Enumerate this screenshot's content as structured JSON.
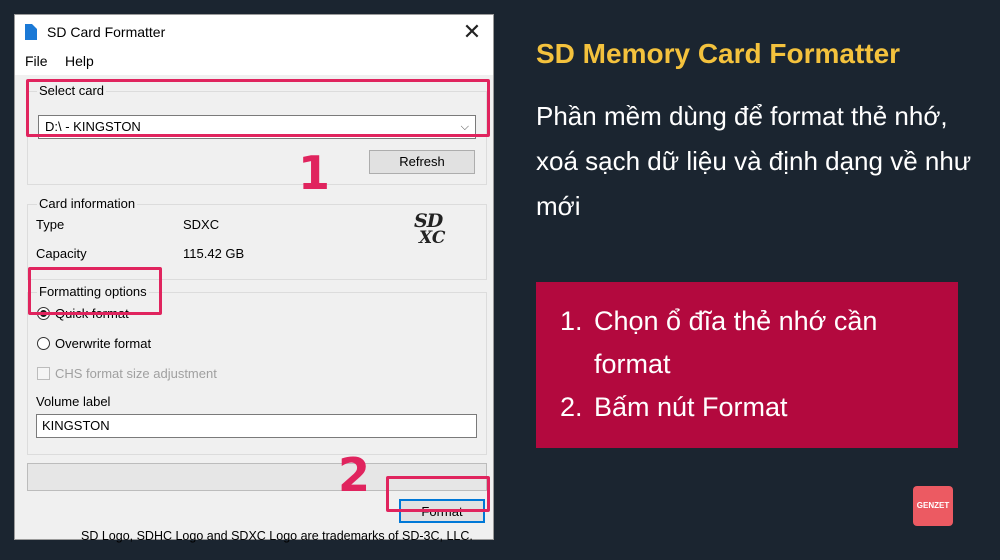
{
  "window": {
    "title": "SD Card Formatter",
    "close_glyph": "✕",
    "menu": [
      "File",
      "Help"
    ]
  },
  "select_card": {
    "group_label": "Select card",
    "selected": "D:\\ - KINGSTON",
    "refresh_label": "Refresh"
  },
  "card_info": {
    "group_label": "Card information",
    "type_label": "Type",
    "type_value": "SDXC",
    "capacity_label": "Capacity",
    "capacity_value": "115.42 GB",
    "logo_text_top": "SD",
    "logo_text_bottom": "XC"
  },
  "formatting": {
    "group_label": "Formatting options",
    "quick_format": "Quick format",
    "overwrite_format": "Overwrite format",
    "chs_adjust": "CHS format size adjustment",
    "selected_option": "quick_format",
    "volume_label_title": "Volume label",
    "volume_label_value": "KINGSTON"
  },
  "progress": {
    "value": 0
  },
  "format_button": "Format",
  "trademark": "SD Logo, SDHC Logo and SDXC Logo are trademarks of SD-3C, LLC.",
  "annotations": {
    "step1": "1",
    "step2": "2",
    "color": "#e0245e"
  },
  "panel": {
    "heading": "SD Memory Card Formatter",
    "description": "Phần mềm dùng để format thẻ nhớ, xoá sạch dữ liệu và định dạng về như mới",
    "steps": [
      "Chọn ổ đĩa thẻ nhớ cần format",
      "Bấm nút Format"
    ],
    "box_color": "#b3093e",
    "heading_color": "#f4c23d"
  },
  "brand_logo": "GENZET"
}
